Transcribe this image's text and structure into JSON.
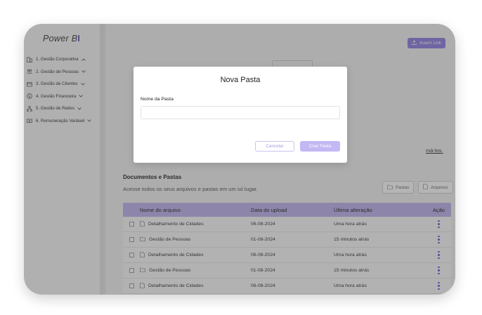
{
  "app": {
    "logo_text": "Power B",
    "logo_mark": "I"
  },
  "sidebar": {
    "items": [
      {
        "label": "1. Gestão Corporativa",
        "icon": "building-icon",
        "expanded": true
      },
      {
        "label": "2. Gestão de Pessoas",
        "icon": "people-icon",
        "expanded": false
      },
      {
        "label": "3. Gestão de Clientes",
        "icon": "clients-icon",
        "expanded": false
      },
      {
        "label": "4. Gestão Financeira",
        "icon": "dollar-icon",
        "expanded": false
      },
      {
        "label": "5. Gestão de Redes",
        "icon": "network-icon",
        "expanded": false
      },
      {
        "label": "6. Remuneração Variável",
        "icon": "money-icon",
        "expanded": false
      }
    ]
  },
  "header": {
    "insert_link_label": "Inserir Link"
  },
  "background": {
    "partial_text": "má-los."
  },
  "documents": {
    "title": "Documentos e Pastas",
    "subtitle": "Acesse todos os seus arquivos e pastas em um só lugar.",
    "folders_label": "Pastas",
    "files_label": "Arquivos",
    "columns": [
      "Nome do arquivo",
      "Data do upload",
      "Última alteração",
      "Ação"
    ],
    "rows": [
      {
        "type": "file",
        "name": "Detalhamento de Cidades",
        "date": "06-08-2024",
        "altered": "Uma hora atrás"
      },
      {
        "type": "folder",
        "name": "Gestão de Pessoas",
        "date": "01-08-2024",
        "altered": "15 minutos atrás"
      },
      {
        "type": "file",
        "name": "Detalhamento de Cidades",
        "date": "06-08-2024",
        "altered": "Uma hora atrás"
      },
      {
        "type": "folder",
        "name": "Gestão de Pessoas",
        "date": "01-08-2024",
        "altered": "15 minutos atrás"
      },
      {
        "type": "file",
        "name": "Detalhamento de Cidades",
        "date": "06-08-2024",
        "altered": "Uma hora atrás"
      }
    ]
  },
  "modal": {
    "title": "Nova Pasta",
    "field_label": "Nome da Pasta",
    "field_value": "",
    "field_placeholder": "",
    "cancel_label": "Cancelar",
    "create_label": "Criar Pasta"
  },
  "colors": {
    "accent": "#8f7fe0",
    "header_row": "#bfb4ee",
    "kebab": "#6a55d8"
  }
}
